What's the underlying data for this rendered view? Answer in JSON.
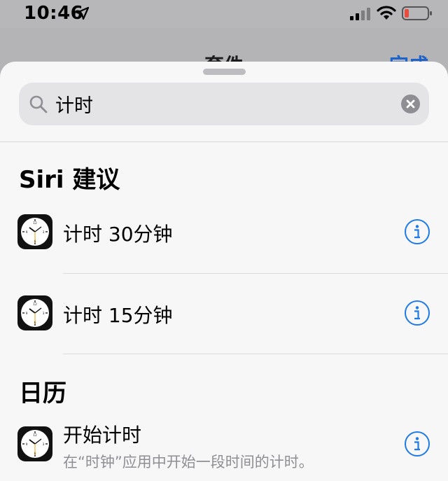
{
  "status_bar": {
    "time": "10:46",
    "icons": [
      "location-arrow-icon",
      "cellular-signal-icon",
      "wifi-icon",
      "battery-low-icon"
    ],
    "battery_color": "#e74c3c"
  },
  "background_nav": {
    "title_partial": "套件",
    "done_partial": "完成"
  },
  "search": {
    "value": "计时",
    "placeholder": ""
  },
  "sections": [
    {
      "header": "Siri 建议",
      "rows": [
        {
          "title": "计时 30分钟",
          "subtitle": ""
        },
        {
          "title": "计时 15分钟",
          "subtitle": ""
        }
      ]
    },
    {
      "header": "日历",
      "rows": [
        {
          "title": "开始计时",
          "subtitle": "在“时钟”应用中开始一段时间的计时。"
        }
      ]
    }
  ],
  "colors": {
    "accent": "#1f7ae8",
    "sheet_bg": "#f7f7f8",
    "search_bg": "#e4e4e7",
    "secondary_text": "#8e8e93"
  }
}
